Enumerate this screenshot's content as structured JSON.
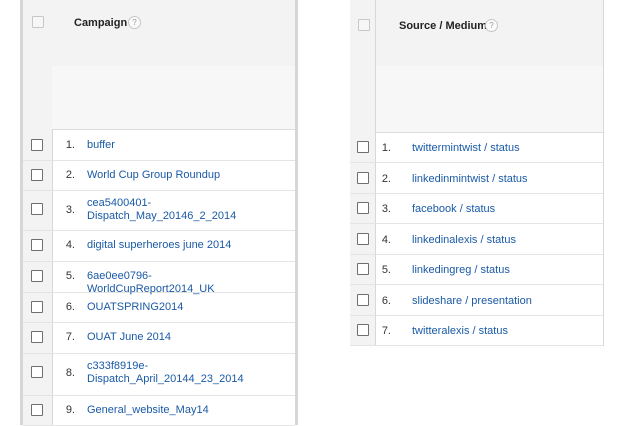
{
  "campaign_table": {
    "header": "Campaign",
    "help_glyph": "?",
    "rows": [
      {
        "num": "1.",
        "label": "buffer"
      },
      {
        "num": "2.",
        "label": "World Cup Group Roundup"
      },
      {
        "num": "3.",
        "label": "cea5400401-Dispatch_May_20146_2_2014"
      },
      {
        "num": "4.",
        "label": "digital superheroes june 2014"
      },
      {
        "num": "5.",
        "label": "6ae0ee0796-WorldCupReport2014_UK"
      },
      {
        "num": "6.",
        "label": "OUATSPRING2014"
      },
      {
        "num": "7.",
        "label": "OUAT June 2014"
      },
      {
        "num": "8.",
        "label": "c333f8919e-Dispatch_April_20144_23_2014"
      },
      {
        "num": "9.",
        "label": "General_website_May14"
      }
    ]
  },
  "source_medium_table": {
    "header": "Source / Medium",
    "help_glyph": "?",
    "rows": [
      {
        "num": "1.",
        "label": "twittermintwist / status"
      },
      {
        "num": "2.",
        "label": "linkedinmintwist / status"
      },
      {
        "num": "3.",
        "label": "facebook / status"
      },
      {
        "num": "4.",
        "label": "linkedinalexis / status"
      },
      {
        "num": "5.",
        "label": "linkedingreg / status"
      },
      {
        "num": "6.",
        "label": "slideshare / presentation"
      },
      {
        "num": "7.",
        "label": "twitteralexis / status"
      }
    ]
  },
  "colors": {
    "link": "#1a5aa6",
    "header_bg": "#f3f3f3",
    "border": "#d8d8d8"
  }
}
